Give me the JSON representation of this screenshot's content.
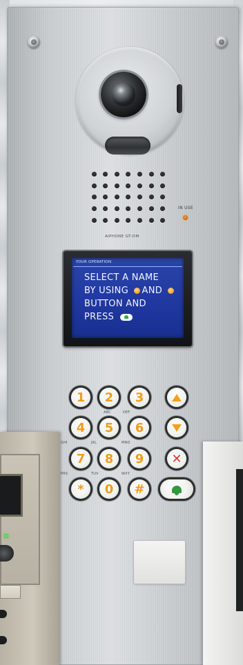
{
  "panel": {
    "brand_label": "AIPHONE  GT-DM",
    "inuse_label": "IN USE"
  },
  "lcd": {
    "header": "YOUR OPERATION",
    "line1": "SELECT A NAME",
    "line2_a": "BY USING",
    "line2_b": "AND",
    "line3": "BUTTON AND",
    "line4": "PRESS"
  },
  "keypad": {
    "keys": [
      "1",
      "2",
      "3",
      "4",
      "5",
      "6",
      "7",
      "8",
      "9",
      "*",
      "0",
      "#"
    ],
    "sub_labels": {
      "k2": "ABC",
      "k3": "DEF",
      "k4": "GHI",
      "k5": "JKL",
      "k6": "MNO",
      "k7": "PRS",
      "k8": "TUV",
      "k9": "WXY"
    },
    "up_icon": "arrow-up-icon",
    "down_icon": "arrow-down-icon",
    "clear_icon": "clear-x-icon",
    "call_icon": "bell-call-icon"
  },
  "colors": {
    "key_digit": "#f29b1c",
    "lcd_background": "#1f37a0",
    "call_green": "#2e9a3e",
    "clear_red": "#d53a2a"
  }
}
